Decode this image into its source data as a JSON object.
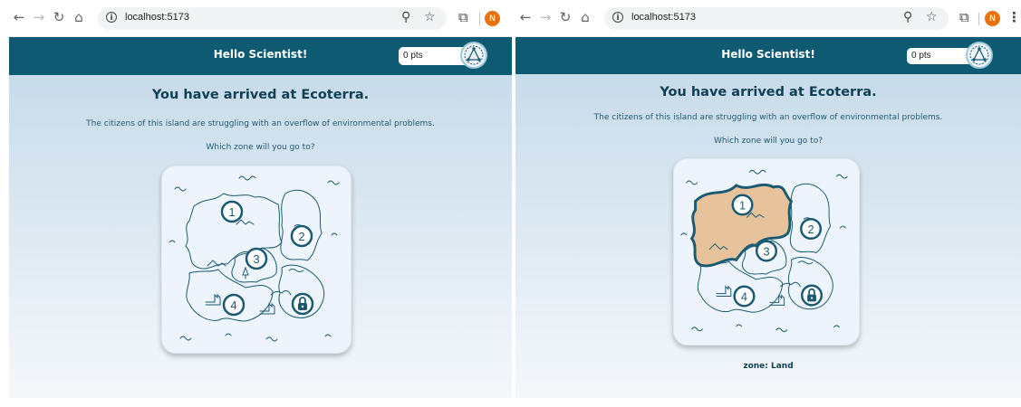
{
  "browser": {
    "url": "localhost:5173",
    "avatar_initial": "N",
    "icons": [
      "back-icon",
      "forward-icon",
      "reload-icon",
      "home-icon",
      "info-icon",
      "zoom-icon",
      "star-icon",
      "extensions-icon",
      "avatar-icon",
      "menu-icon"
    ]
  },
  "app": {
    "greeting": "Hello Scientist!",
    "points": "0 pts",
    "heading": "You have arrived at Ecoterra.",
    "intro": "The citizens of this island are struggling with an overflow of environmental problems.",
    "question": "Which zone will you go to?",
    "zones": [
      {
        "number": "1"
      },
      {
        "number": "2"
      },
      {
        "number": "3"
      },
      {
        "number": "4"
      },
      {
        "locked": true,
        "icon": "padlock-icon"
      }
    ],
    "colors": {
      "header": "#0e5a73",
      "highlight": "#e6c39b",
      "outline": "#1b5a73",
      "avatar": "#e8710a"
    }
  },
  "right_pane": {
    "selected_zone": "zone: Land"
  }
}
